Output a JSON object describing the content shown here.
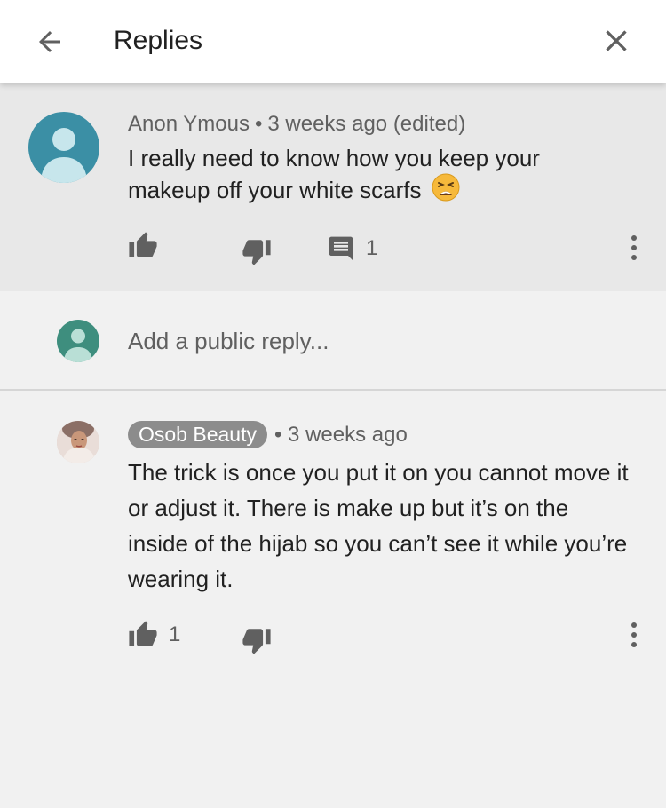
{
  "header": {
    "title": "Replies"
  },
  "parent_comment": {
    "author": "Anon Ymous",
    "separator": "•",
    "time": "3 weeks ago (edited)",
    "text": "I really need to know how you keep your makeup off your white scarfs",
    "emoji": "tired-face",
    "reply_count": "1"
  },
  "reply_box": {
    "placeholder": "Add a public reply..."
  },
  "reply": {
    "author": "Osob Beauty",
    "separator": "•",
    "time": "3 weeks ago",
    "text": "The trick is once you put it on you cannot move it or adjust it. There is make up but it’s on the inside of the hijab so you can’t see it while you’re wearing it.",
    "like_count": "1"
  },
  "colors": {
    "icon_gray": "#606060",
    "avatar_parent": "#3b8fa5",
    "avatar_self": "#3e8e7e",
    "author_badge": "#8c8c8c"
  }
}
